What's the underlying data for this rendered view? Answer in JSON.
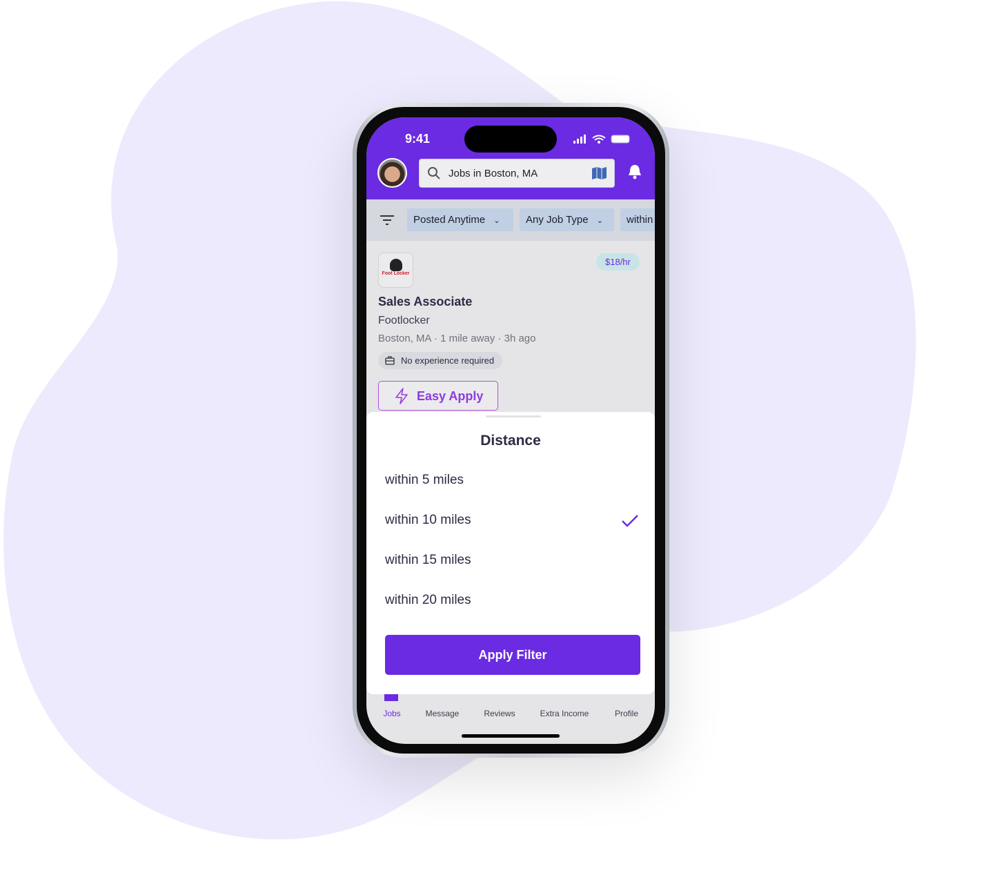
{
  "status_bar": {
    "time": "9:41"
  },
  "header": {
    "search_text": "Jobs in Boston, MA",
    "icons": [
      "avatar",
      "search-icon",
      "map-icon",
      "bell-icon"
    ]
  },
  "filters": {
    "chips": [
      "Posted Anytime",
      "Any Job Type",
      "within"
    ]
  },
  "job": {
    "logo_text": "Foot Locker",
    "pay": "$18/hr",
    "title": "Sales Associate",
    "company": "Footlocker",
    "location": "Boston, MA",
    "distance": "1 mile away",
    "posted": "3h ago",
    "tag": "No experience required",
    "easy_apply": "Easy Apply"
  },
  "sheet": {
    "title": "Distance",
    "options": [
      "within 5 miles",
      "within 10 miles",
      "within 15 miles",
      "within 20 miles"
    ],
    "selected": "within 10 miles",
    "apply_label": "Apply Filter"
  },
  "tabs": [
    {
      "label": "Jobs",
      "active": true
    },
    {
      "label": "Message"
    },
    {
      "label": "Reviews"
    },
    {
      "label": "Extra Income"
    },
    {
      "label": "Profile"
    }
  ],
  "colors": {
    "brand": "#6a2be2",
    "background_blob": "#ECEAFC"
  }
}
